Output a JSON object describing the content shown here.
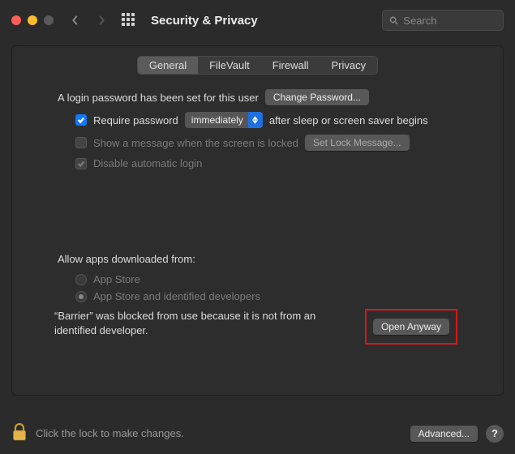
{
  "toolbar": {
    "title": "Security & Privacy",
    "search_placeholder": "Search"
  },
  "tabs": [
    "General",
    "FileVault",
    "Firewall",
    "Privacy"
  ],
  "login": {
    "password_set_text": "A login password has been set for this user",
    "change_password_btn": "Change Password...",
    "require_password_label": "Require password",
    "delay_value": "immediately",
    "after_text": "after sleep or screen saver begins",
    "show_message_label": "Show a message when the screen is locked",
    "set_lock_message_btn": "Set Lock Message...",
    "disable_auto_login_label": "Disable automatic login"
  },
  "allow": {
    "title": "Allow apps downloaded from:",
    "opt_appstore": "App Store",
    "opt_identified": "App Store and identified developers",
    "blocked_text": "“Barrier” was blocked from use because it is not from an identified developer.",
    "open_anyway_btn": "Open Anyway"
  },
  "footer": {
    "lock_text": "Click the lock to make changes.",
    "advanced_btn": "Advanced...",
    "help": "?"
  }
}
